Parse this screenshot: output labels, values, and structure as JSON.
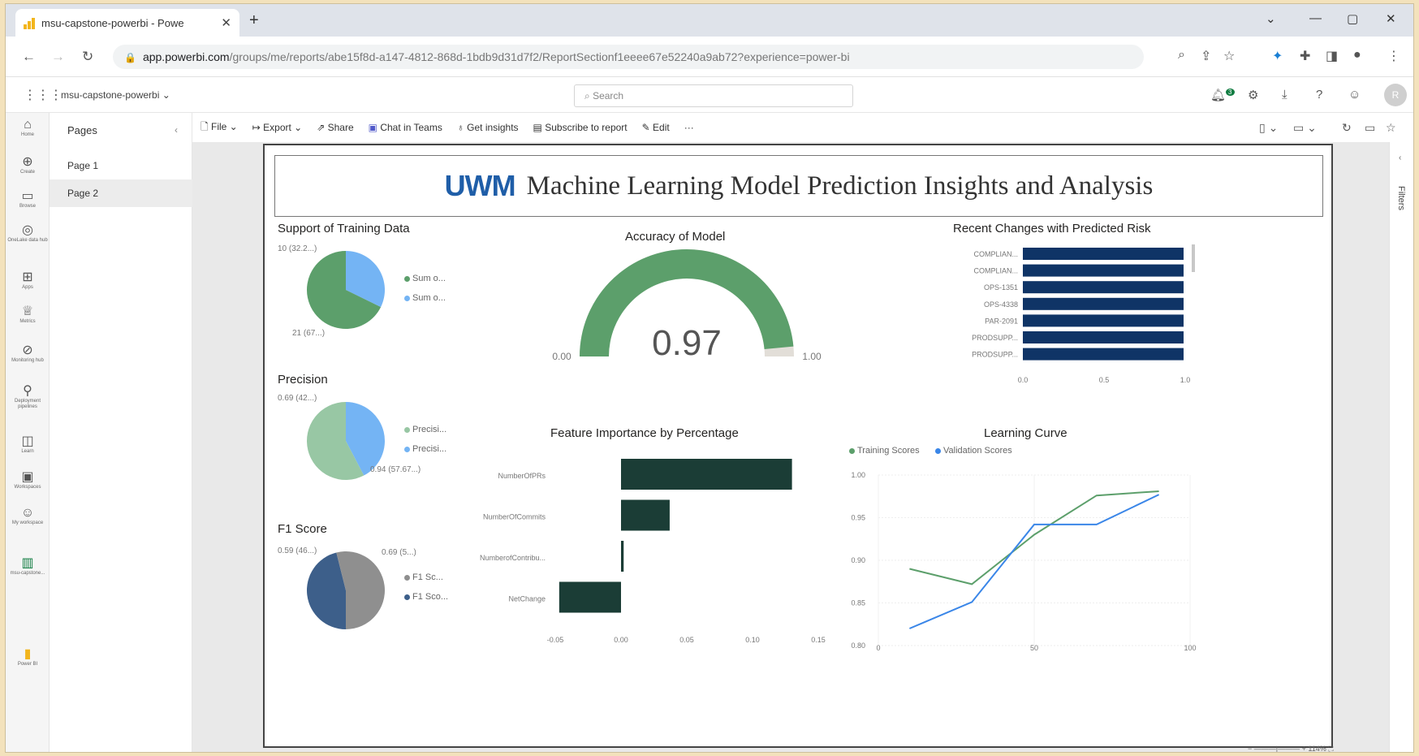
{
  "browser": {
    "tab_title": "msu-capstone-powerbi - Powe",
    "tab_close": "✕",
    "new_tab": "+",
    "url_host": "app.powerbi.com",
    "url_path": "/groups/me/reports/abe15f8d-a147-4812-868d-1bdb9d31d7f2/ReportSectionf1eeee67e52240a9ab72?experience=power-bi"
  },
  "powerbi": {
    "workspace": "msu-capstone-powerbi",
    "search_placeholder": "Search",
    "notification_count": "3",
    "avatar": "R"
  },
  "rail": [
    {
      "label": "Home",
      "icon": "home-icon",
      "glyph": "⌂"
    },
    {
      "label": "Create",
      "icon": "create-icon",
      "glyph": "⊕"
    },
    {
      "label": "Browse",
      "icon": "browse-icon",
      "glyph": "▭"
    },
    {
      "label": "OneLake data hub",
      "icon": "onelake-icon",
      "glyph": "◎"
    },
    {
      "label": "Apps",
      "icon": "apps-icon",
      "glyph": "⊞"
    },
    {
      "label": "Metrics",
      "icon": "metrics-icon",
      "glyph": "♕"
    },
    {
      "label": "Monitoring hub",
      "icon": "monitoring-icon",
      "glyph": "⊘"
    },
    {
      "label": "Deployment pipelines",
      "icon": "pipeline-icon",
      "glyph": "⚲"
    },
    {
      "label": "Learn",
      "icon": "learn-icon",
      "glyph": "◫"
    },
    {
      "label": "Workspaces",
      "icon": "workspaces-icon",
      "glyph": "▣"
    },
    {
      "label": "My workspace",
      "icon": "my-workspace-icon",
      "glyph": "☺"
    },
    {
      "label": "msu-capstone...",
      "icon": "report-icon",
      "glyph": "▥"
    },
    {
      "label": "Power BI",
      "icon": "powerbi-icon",
      "glyph": "▮"
    }
  ],
  "pages": {
    "title": "Pages",
    "items": [
      "Page 1",
      "Page 2"
    ],
    "active": 1
  },
  "toolbar": {
    "file": "File",
    "export": "Export",
    "share": "Share",
    "chat": "Chat in Teams",
    "insights": "Get insights",
    "subscribe": "Subscribe to report",
    "edit": "Edit",
    "more": "···"
  },
  "report": {
    "logo": "UWM",
    "title": "Machine Learning Model Prediction Insights and Analysis",
    "filters_label": "Filters"
  },
  "colors": {
    "green": "#5c9f6b",
    "light_green": "#98c7a4",
    "blue_light": "#74b4f4",
    "navy": "#0f3466",
    "dark_teal": "#1b3d36",
    "gray": "#8f8f8f",
    "steel": "#3d5f8a",
    "blue_line": "#3a86e8"
  },
  "chart_data": [
    {
      "type": "pie",
      "title": "Support of Training Data",
      "slices": [
        {
          "label": "10 (32.2...)",
          "value": 10
        },
        {
          "label": "21 (67...)",
          "value": 21
        }
      ],
      "legend": [
        "Sum o...",
        "Sum o..."
      ]
    },
    {
      "type": "pie",
      "title": "Precision",
      "slices": [
        {
          "label": "0.69 (42...)",
          "value": 0.69
        },
        {
          "label": "0.94 (57.67...)",
          "value": 0.94
        }
      ],
      "legend": [
        "Precisi...",
        "Precisi..."
      ]
    },
    {
      "type": "pie",
      "title": "F1 Score",
      "slices": [
        {
          "label": "0.59 (46...)",
          "value": 0.59
        },
        {
          "label": "0.69 (5...)",
          "value": 0.69
        }
      ],
      "legend": [
        "F1 Sc...",
        "F1 Sco..."
      ]
    },
    {
      "type": "gauge",
      "title": "Accuracy of Model",
      "value": 0.97,
      "value_label": "0.97",
      "min": 0,
      "max": 1,
      "min_label": "0.00",
      "max_label": "1.00"
    },
    {
      "type": "bar",
      "orientation": "horizontal",
      "title": "Recent Changes with Predicted Risk",
      "categories": [
        "COMPLIAN...",
        "COMPLIAN...",
        "OPS-1351",
        "OPS-4338",
        "PAR-2091",
        "PRODSUPP...",
        "PRODSUPP..."
      ],
      "values": [
        0.99,
        0.99,
        0.99,
        0.99,
        0.99,
        0.99,
        0.99
      ],
      "xlim": [
        0,
        1
      ],
      "xticks": [
        "0.0",
        "0.5",
        "1.0"
      ]
    },
    {
      "type": "bar",
      "orientation": "horizontal",
      "title": "Feature Importance by Percentage",
      "categories": [
        "NumberOfPRs",
        "NumberOfCommits",
        "NumberofContribu...",
        "NetChange"
      ],
      "values": [
        0.13,
        0.037,
        0.002,
        -0.047
      ],
      "xlim": [
        -0.05,
        0.15
      ],
      "xticks": [
        "-0.05",
        "0.00",
        "0.05",
        "0.10",
        "0.15"
      ]
    },
    {
      "type": "line",
      "title": "Learning Curve",
      "x": [
        10,
        30,
        50,
        70,
        90
      ],
      "series": [
        {
          "name": "Training Scores",
          "values": [
            0.89,
            0.872,
            0.93,
            0.976,
            0.981
          ]
        },
        {
          "name": "Validation Scores",
          "values": [
            0.82,
            0.851,
            0.942,
            0.942,
            0.977
          ]
        }
      ],
      "ylim": [
        0.8,
        1.0
      ],
      "xlim": [
        0,
        100
      ],
      "yticks": [
        "1.00",
        "0.95",
        "0.90",
        "0.85",
        "0.80"
      ],
      "xticks": [
        "0",
        "50",
        "100"
      ]
    }
  ],
  "status": {
    "zoom": "114%"
  }
}
